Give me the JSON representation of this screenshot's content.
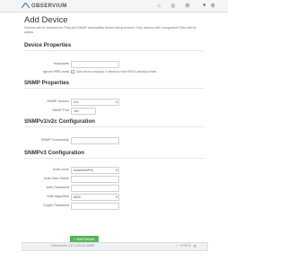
{
  "app": {
    "logo_text": "OBSERVIUM"
  },
  "nav": {
    "icons": [
      "home-icon",
      "globe-icon",
      "gear-icon"
    ],
    "right_items": [
      "user-icon",
      "gear-icon"
    ]
  },
  "page": {
    "title": "Add Device",
    "intro": "Devices will be checked for Ping and SNMP reachability before being probed. Only devices with recognised OSes will be added."
  },
  "sections": {
    "device_properties": "Device Properties",
    "snmp_properties": "SNMP Properties",
    "snmp_v12c": "SNMPv1/v2c Configuration",
    "snmp_v3": "SNMPv3 Configuration"
  },
  "fields": {
    "hostname": {
      "label": "Hostname",
      "value": ""
    },
    "ignore_rrd": {
      "label": "Ignore RRD exist",
      "checkbox_label": "Add device anyway if directory with RRDs already exists"
    },
    "snmp_version": {
      "label": "SNMP Version",
      "value": "v2c"
    },
    "snmp_port": {
      "label": "SNMP Port",
      "value": "161"
    },
    "snmp_community": {
      "label": "SNMP Community",
      "value": ""
    },
    "auth_level": {
      "label": "Auth Level",
      "value": "noAuthNoPriv"
    },
    "auth_username": {
      "label": "Auth User Name",
      "value": ""
    },
    "auth_password": {
      "label": "Auth Password",
      "value": ""
    },
    "auth_algorithm": {
      "label": "Auth Algorithm",
      "value": "MD5"
    },
    "crypto_password": {
      "label": "Crypto Password",
      "value": ""
    }
  },
  "actions": {
    "add_device": "Add Device"
  },
  "footer": {
    "left": "Observium CE 0.15.10.6585",
    "right": "0.017s"
  }
}
